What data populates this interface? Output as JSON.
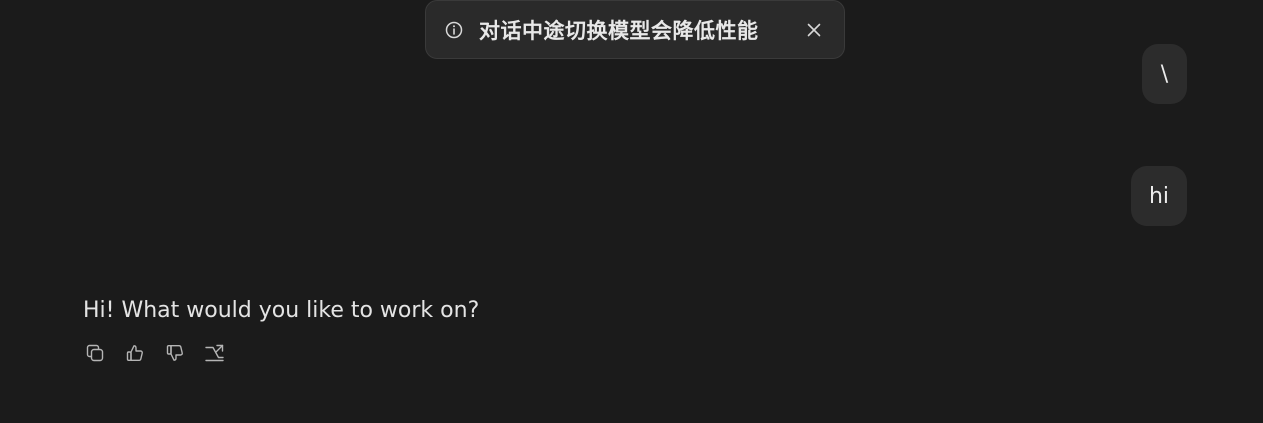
{
  "toast": {
    "message": "对话中途切换模型会降低性能",
    "icon": "info-icon",
    "close_icon": "close-icon"
  },
  "messages": {
    "user": [
      {
        "text": "\\"
      },
      {
        "text": "hi"
      }
    ],
    "assistant": {
      "text": "Hi! What would you like to work on?"
    }
  },
  "actions": [
    {
      "icon": "copy-icon"
    },
    {
      "icon": "thumbs-up-icon"
    },
    {
      "icon": "thumbs-down-icon"
    },
    {
      "icon": "share-icon"
    }
  ],
  "colors": {
    "background": "#1b1b1b",
    "bubble": "#2c2c2c",
    "toast_bg": "#2a2a2a",
    "icon": "#b5b5b5"
  }
}
